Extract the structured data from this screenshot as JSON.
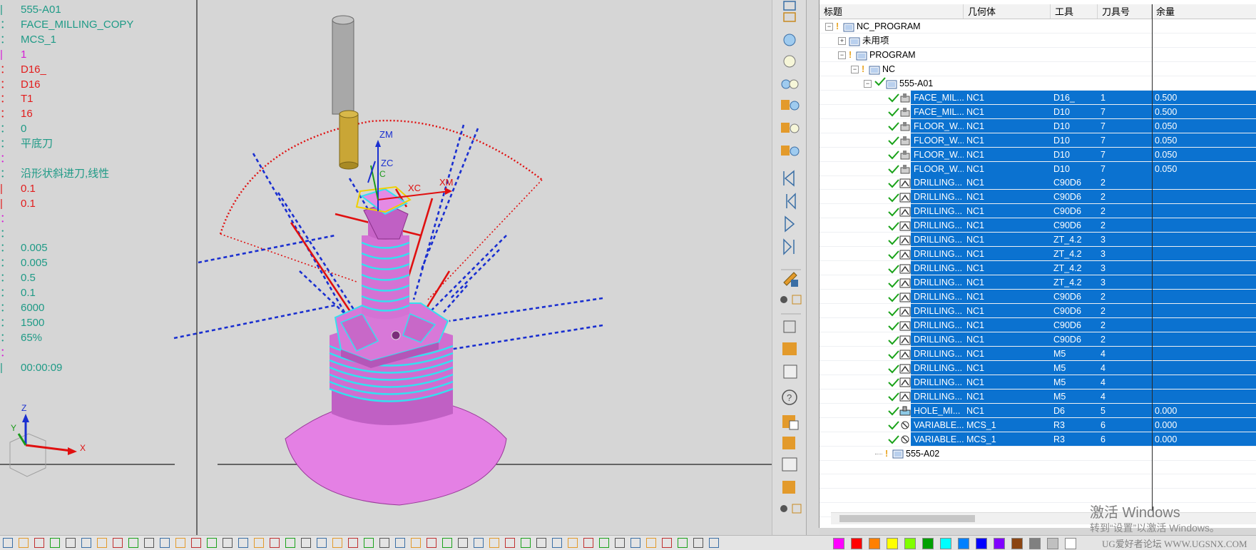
{
  "info_panel": {
    "rows": [
      {
        "label": "|",
        "value": "555-A01",
        "color": "teal"
      },
      {
        "label": "：",
        "value": "FACE_MILLING_COPY",
        "color": "teal"
      },
      {
        "label": "：",
        "value": "MCS_1",
        "color": "teal"
      },
      {
        "label": "|",
        "value": "1",
        "color": "mag"
      },
      {
        "label": "：",
        "value": "D16_",
        "color": "red"
      },
      {
        "label": "：",
        "value": "D16",
        "color": "red"
      },
      {
        "label": "：",
        "value": "T1",
        "color": "red"
      },
      {
        "label": "：",
        "value": "16",
        "color": "red"
      },
      {
        "label": "：",
        "value": "0",
        "color": "teal"
      },
      {
        "label": "：",
        "value": "平底刀",
        "color": "teal"
      },
      {
        "label": "：",
        "value": "",
        "color": "mag"
      },
      {
        "label": "：",
        "value": "沿形状斜进刀,线性",
        "color": "teal"
      },
      {
        "label": "|",
        "value": "0.1",
        "color": "red"
      },
      {
        "label": "|",
        "value": "0.1",
        "color": "red"
      },
      {
        "label": "：",
        "value": "",
        "color": "mag"
      },
      {
        "label": "：",
        "value": "",
        "color": "teal"
      },
      {
        "label": "：",
        "value": "0.005",
        "color": "teal"
      },
      {
        "label": "：",
        "value": "0.005",
        "color": "teal"
      },
      {
        "label": "：",
        "value": "0.5",
        "color": "teal"
      },
      {
        "label": "：",
        "value": "0.1",
        "color": "teal"
      },
      {
        "label": "：",
        "value": "6000",
        "color": "teal"
      },
      {
        "label": "：",
        "value": "1500",
        "color": "teal"
      },
      {
        "label": "：",
        "value": "65%",
        "color": "teal"
      },
      {
        "label": "：",
        "value": "",
        "color": "mag"
      },
      {
        "label": "|",
        "value": "00:00:09",
        "color": "teal"
      }
    ]
  },
  "viewport": {
    "axis_labels": {
      "zm": "ZM",
      "zc": "ZC",
      "xc": "XC",
      "xm": "XM",
      "c": "C"
    },
    "triad_labels": {
      "z": "Z",
      "y": "Y",
      "x": "X"
    },
    "colors": {
      "part": "#e07ee0",
      "part_dark": "#c660c8",
      "edge": "#34e0f0",
      "tool_shank": "#a9a9a9",
      "tool_holder": "#c9a636",
      "path_blue": "#1a2fd0",
      "path_red": "#e01010",
      "arc_red": "#e01010"
    }
  },
  "navigator": {
    "columns": [
      "标题",
      "几何体",
      "工具",
      "刀具号",
      "余量"
    ],
    "tree": [
      {
        "name": "NC_PROGRAM",
        "level": 0,
        "expander": "-",
        "icon": "folder",
        "warn": true,
        "check": false
      },
      {
        "name": "未用项",
        "level": 1,
        "expander": "+",
        "icon": "folder",
        "warn": false,
        "check": false
      },
      {
        "name": "PROGRAM",
        "level": 1,
        "expander": "-",
        "icon": "folder",
        "warn": true,
        "check": false
      },
      {
        "name": "NC",
        "level": 2,
        "expander": "-",
        "icon": "folder",
        "warn": true,
        "check": false
      },
      {
        "name": "555-A01",
        "level": 3,
        "expander": "-",
        "icon": "folder",
        "warn": false,
        "check": true
      }
    ],
    "operations": [
      {
        "name": "FACE_MIL...",
        "icon": "mill",
        "geometry": "NC1",
        "tool": "D16_",
        "tool_no": "1",
        "stock": "0.500"
      },
      {
        "name": "FACE_MIL...",
        "icon": "mill",
        "geometry": "NC1",
        "tool": "D10",
        "tool_no": "7",
        "stock": "0.500"
      },
      {
        "name": "FLOOR_W...",
        "icon": "mill",
        "geometry": "NC1",
        "tool": "D10",
        "tool_no": "7",
        "stock": "0.050"
      },
      {
        "name": "FLOOR_W...",
        "icon": "mill",
        "geometry": "NC1",
        "tool": "D10",
        "tool_no": "7",
        "stock": "0.050"
      },
      {
        "name": "FLOOR_W...",
        "icon": "mill",
        "geometry": "NC1",
        "tool": "D10",
        "tool_no": "7",
        "stock": "0.050"
      },
      {
        "name": "FLOOR_W...",
        "icon": "mill",
        "geometry": "NC1",
        "tool": "D10",
        "tool_no": "7",
        "stock": "0.050"
      },
      {
        "name": "DRILLING...",
        "icon": "drill",
        "geometry": "NC1",
        "tool": "C90D6",
        "tool_no": "2",
        "stock": ""
      },
      {
        "name": "DRILLING...",
        "icon": "drill",
        "geometry": "NC1",
        "tool": "C90D6",
        "tool_no": "2",
        "stock": ""
      },
      {
        "name": "DRILLING...",
        "icon": "drill",
        "geometry": "NC1",
        "tool": "C90D6",
        "tool_no": "2",
        "stock": ""
      },
      {
        "name": "DRILLING...",
        "icon": "drill",
        "geometry": "NC1",
        "tool": "C90D6",
        "tool_no": "2",
        "stock": ""
      },
      {
        "name": "DRILLING...",
        "icon": "drill",
        "geometry": "NC1",
        "tool": "ZT_4.2",
        "tool_no": "3",
        "stock": ""
      },
      {
        "name": "DRILLING...",
        "icon": "drill",
        "geometry": "NC1",
        "tool": "ZT_4.2",
        "tool_no": "3",
        "stock": ""
      },
      {
        "name": "DRILLING...",
        "icon": "drill",
        "geometry": "NC1",
        "tool": "ZT_4.2",
        "tool_no": "3",
        "stock": ""
      },
      {
        "name": "DRILLING...",
        "icon": "drill",
        "geometry": "NC1",
        "tool": "ZT_4.2",
        "tool_no": "3",
        "stock": ""
      },
      {
        "name": "DRILLING...",
        "icon": "drill",
        "geometry": "NC1",
        "tool": "C90D6",
        "tool_no": "2",
        "stock": ""
      },
      {
        "name": "DRILLING...",
        "icon": "drill",
        "geometry": "NC1",
        "tool": "C90D6",
        "tool_no": "2",
        "stock": ""
      },
      {
        "name": "DRILLING...",
        "icon": "drill",
        "geometry": "NC1",
        "tool": "C90D6",
        "tool_no": "2",
        "stock": ""
      },
      {
        "name": "DRILLING...",
        "icon": "drill",
        "geometry": "NC1",
        "tool": "C90D6",
        "tool_no": "2",
        "stock": ""
      },
      {
        "name": "DRILLING...",
        "icon": "drill",
        "geometry": "NC1",
        "tool": "M5",
        "tool_no": "4",
        "stock": ""
      },
      {
        "name": "DRILLING...",
        "icon": "drill",
        "geometry": "NC1",
        "tool": "M5",
        "tool_no": "4",
        "stock": ""
      },
      {
        "name": "DRILLING...",
        "icon": "drill",
        "geometry": "NC1",
        "tool": "M5",
        "tool_no": "4",
        "stock": ""
      },
      {
        "name": "DRILLING...",
        "icon": "drill",
        "geometry": "NC1",
        "tool": "M5",
        "tool_no": "4",
        "stock": ""
      },
      {
        "name": "HOLE_MI...",
        "icon": "holemill",
        "geometry": "NC1",
        "tool": "D6",
        "tool_no": "5",
        "stock": "0.000"
      },
      {
        "name": "VARIABLE...",
        "icon": "variable",
        "geometry": "MCS_1",
        "tool": "R3",
        "tool_no": "6",
        "stock": "0.000"
      },
      {
        "name": "VARIABLE...",
        "icon": "variable",
        "geometry": "MCS_1",
        "tool": "R3",
        "tool_no": "6",
        "stock": "0.000"
      }
    ],
    "after": {
      "name": "555-A02",
      "icon": "folder",
      "warn": true
    }
  },
  "watermark": {
    "line1": "激活 Windows",
    "line2": "转到“设置”以激活 Windows。",
    "line3": "UG爱好者论坛 WWW.UGSNX.COM"
  },
  "palette": [
    "#ff00ff",
    "#ff0000",
    "#ff8000",
    "#ffff00",
    "#80ff00",
    "#00a000",
    "#00ffff",
    "#0080ff",
    "#0000ff",
    "#8000ff",
    "#8b4513",
    "#808080",
    "#c0c0c0",
    "#ffffff"
  ]
}
